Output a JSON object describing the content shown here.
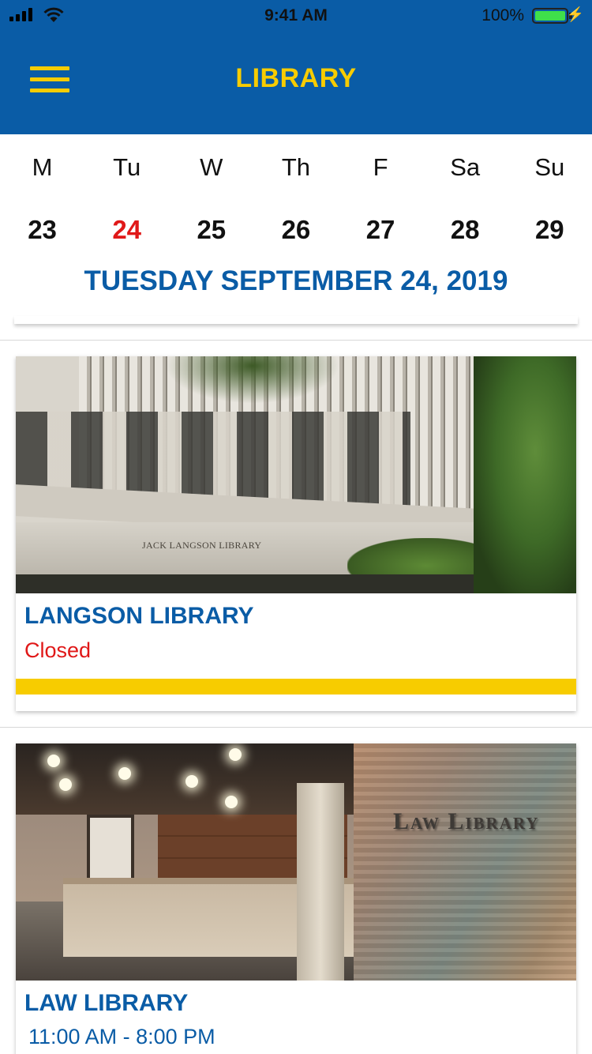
{
  "status_bar": {
    "time": "9:41 AM",
    "battery_percent": "100%",
    "battery_level": 1.0,
    "signal_icon": "signal-icon",
    "wifi_icon": "wifi-icon",
    "charging_icon": "charging-bolt-icon"
  },
  "header": {
    "title": "LIBRARY",
    "menu_icon": "hamburger-menu-icon"
  },
  "calendar": {
    "days": [
      {
        "name": "M",
        "date": "23"
      },
      {
        "name": "Tu",
        "date": "24"
      },
      {
        "name": "W",
        "date": "25"
      },
      {
        "name": "Th",
        "date": "26"
      },
      {
        "name": "F",
        "date": "27"
      },
      {
        "name": "Sa",
        "date": "28"
      },
      {
        "name": "Su",
        "date": "29"
      }
    ],
    "selected_date": "24",
    "full_date": "TUESDAY SEPTEMBER 24, 2019"
  },
  "libraries": [
    {
      "name": "LANGSON LIBRARY",
      "hours": "Closed",
      "status": "closed",
      "photo_sign": "JACK LANGSON LIBRARY"
    },
    {
      "name": "LAW LIBRARY",
      "hours": "11:00 AM - 8:00 PM",
      "status": "open",
      "photo_sign": "Law Library"
    }
  ],
  "colors": {
    "brand_blue": "#0a5ca6",
    "brand_gold": "#f7cc00",
    "selected_red": "#e01818"
  }
}
